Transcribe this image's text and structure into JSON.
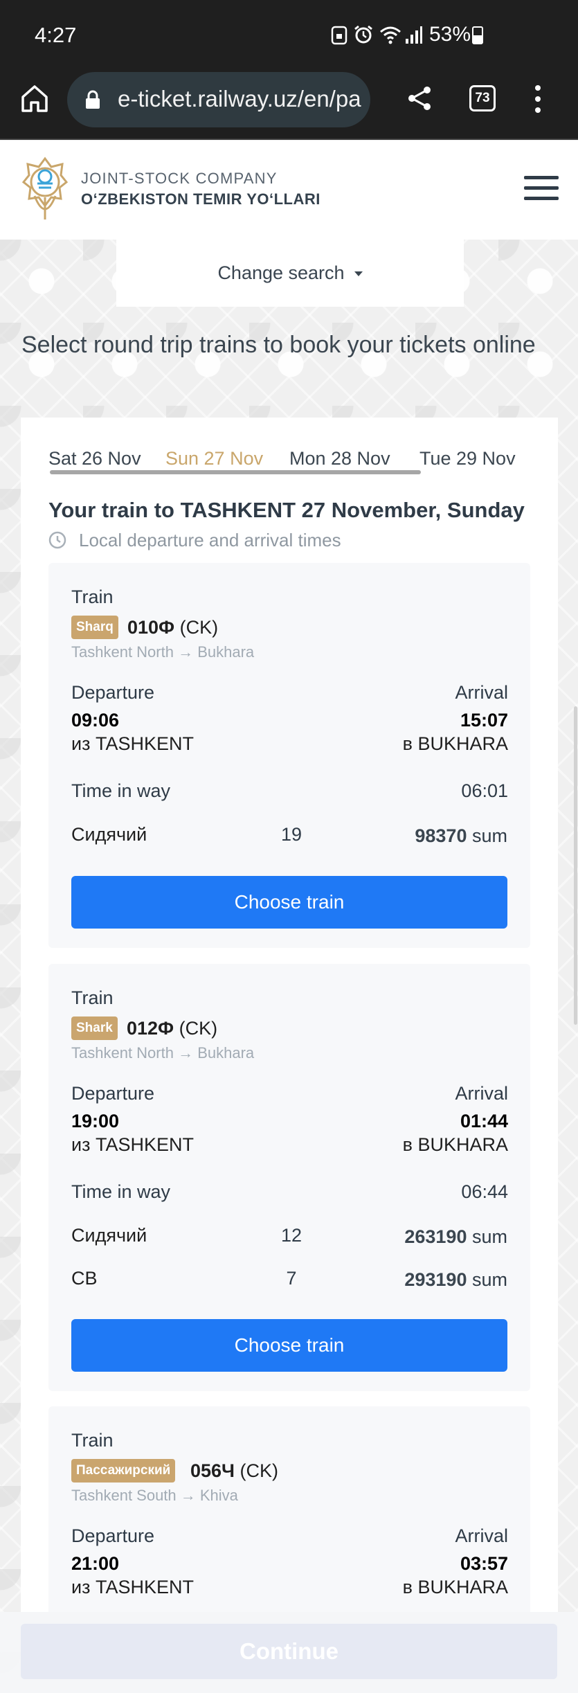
{
  "status_bar": {
    "time": "4:27",
    "battery": "53%"
  },
  "browser": {
    "url": "e-ticket.railway.uz/en/pa",
    "tab_count": "73"
  },
  "header": {
    "company_top": "JOINT-STOCK COMPANY",
    "company_name": "O‘ZBEKISTON TEMIR YO‘LLARI"
  },
  "search": {
    "change_label": "Change search"
  },
  "page": {
    "heading": "Select round trip trains to book your tickets online"
  },
  "dates": {
    "tabs": [
      "Sat 26 Nov",
      "Sun 27 Nov",
      "Mon 28 Nov",
      "Tue 29 Nov"
    ],
    "active_index": 1
  },
  "results": {
    "title": "Your train to TASHKENT 27 November, Sunday",
    "time_note": "Local departure and arrival times"
  },
  "trains": [
    {
      "label": "Train",
      "badge": "Sharq",
      "number": "010Ф",
      "type": "(CK)",
      "route": "Tashkent North → Bukhara",
      "departure_label": "Departure",
      "arrival_label": "Arrival",
      "departure_time": "09:06",
      "arrival_time": "15:07",
      "from": "из TASHKENT",
      "to": "в BUKHARA",
      "time_in_way_label": "Time in way",
      "time_in_way": "06:01",
      "seats": [
        {
          "class": "Сидячий",
          "count": "19",
          "price": "98370",
          "currency": "sum"
        }
      ],
      "button": "Choose train"
    },
    {
      "label": "Train",
      "badge": "Shark",
      "number": "012Ф",
      "type": "(CK)",
      "route": "Tashkent North → Bukhara",
      "departure_label": "Departure",
      "arrival_label": "Arrival",
      "departure_time": "19:00",
      "arrival_time": "01:44",
      "from": "из TASHKENT",
      "to": "в BUKHARA",
      "time_in_way_label": "Time in way",
      "time_in_way": "06:44",
      "seats": [
        {
          "class": "Сидячий",
          "count": "12",
          "price": "263190",
          "currency": "sum"
        },
        {
          "class": "СВ",
          "count": "7",
          "price": "293190",
          "currency": "sum"
        }
      ],
      "button": "Choose train"
    },
    {
      "label": "Train",
      "badge": "Пассажирский",
      "number": "056Ч",
      "type": "(CK)",
      "route": "Tashkent South → Khiva",
      "departure_label": "Departure",
      "arrival_label": "Arrival",
      "departure_time": "21:00",
      "arrival_time": "03:57",
      "from": "из TASHKENT",
      "to": "в BUKHARA"
    }
  ],
  "footer": {
    "continue_label": "Continue"
  },
  "colors": {
    "accent_blue": "#1f79f5",
    "badge_gold": "#caa56e",
    "active_date": "#c9a66b",
    "continue_disabled": "#e6e9f3"
  }
}
